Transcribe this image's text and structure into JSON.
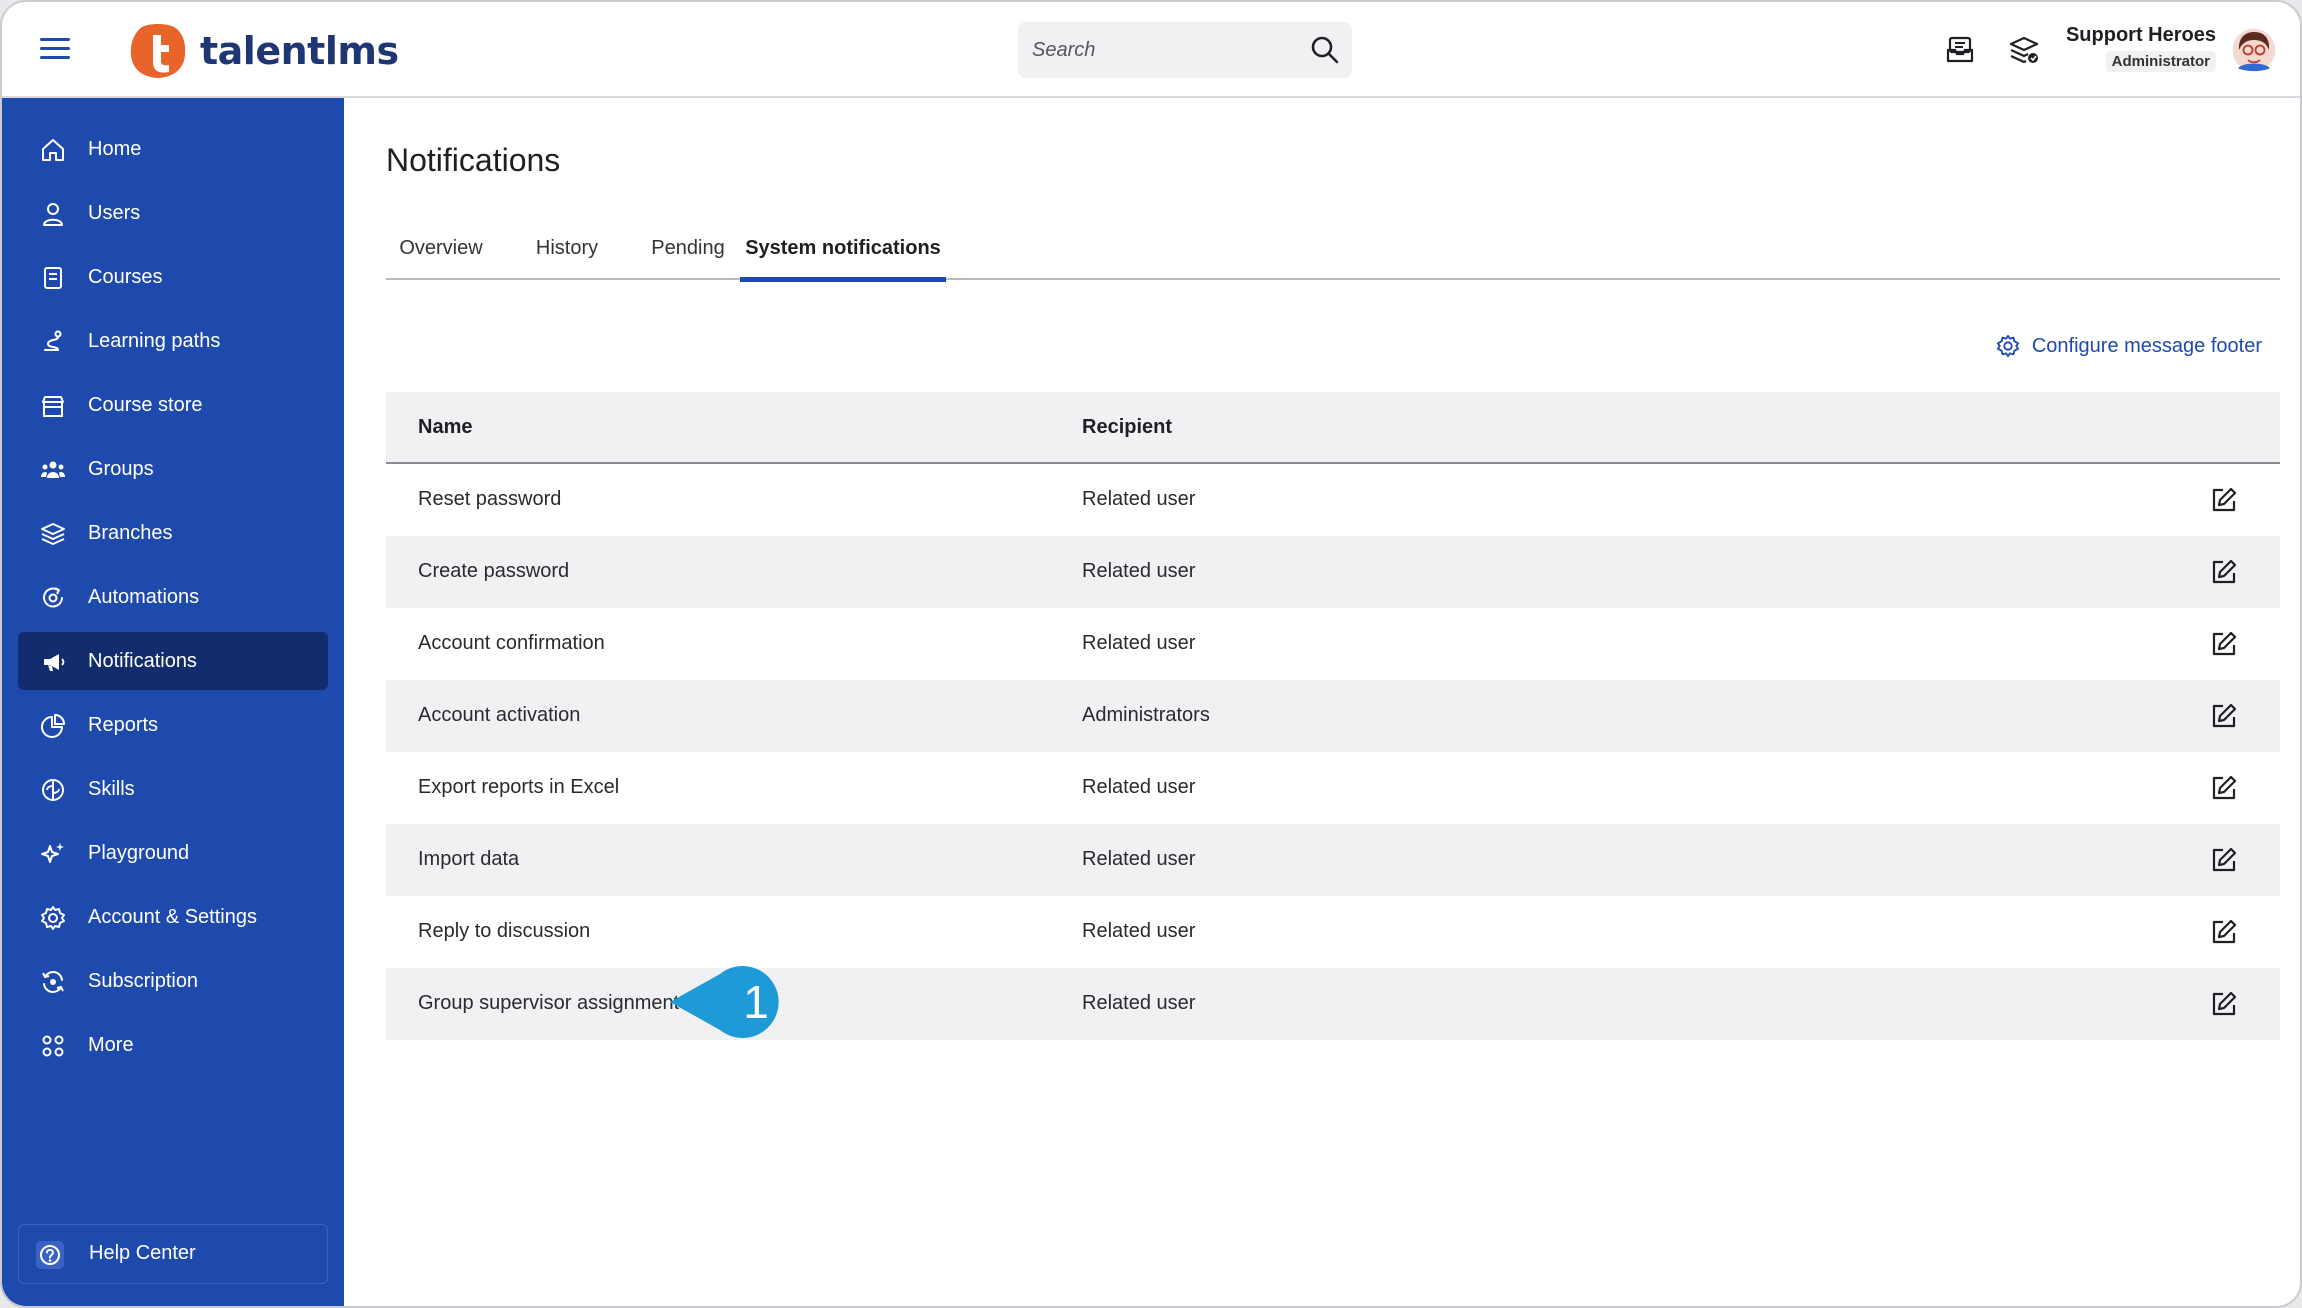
{
  "app": {
    "logo_text": "talentlms",
    "brand_orange": "#e8642a",
    "brand_blue": "#1f4aad"
  },
  "search": {
    "placeholder": "Search"
  },
  "user": {
    "name": "Support Heroes",
    "role": "Administrator"
  },
  "sidebar": {
    "items": [
      {
        "label": "Home",
        "icon": "home-icon"
      },
      {
        "label": "Users",
        "icon": "user-icon"
      },
      {
        "label": "Courses",
        "icon": "book-icon"
      },
      {
        "label": "Learning paths",
        "icon": "path-icon"
      },
      {
        "label": "Course store",
        "icon": "store-icon"
      },
      {
        "label": "Groups",
        "icon": "groups-icon"
      },
      {
        "label": "Branches",
        "icon": "layers-icon"
      },
      {
        "label": "Automations",
        "icon": "automation-icon"
      },
      {
        "label": "Notifications",
        "icon": "megaphone-icon",
        "active": true
      },
      {
        "label": "Reports",
        "icon": "pie-chart-icon"
      },
      {
        "label": "Skills",
        "icon": "brain-icon"
      },
      {
        "label": "Playground",
        "icon": "sparkle-icon"
      },
      {
        "label": "Account & Settings",
        "icon": "gear-icon"
      },
      {
        "label": "Subscription",
        "icon": "subscription-icon"
      },
      {
        "label": "More",
        "icon": "grid-icon"
      }
    ],
    "help": {
      "label": "Help Center",
      "icon": "help-icon"
    }
  },
  "main": {
    "title": "Notifications",
    "tabs": [
      {
        "label": "Overview"
      },
      {
        "label": "History"
      },
      {
        "label": "Pending"
      },
      {
        "label": "System notifications",
        "active": true
      }
    ],
    "config_link": "Configure message footer",
    "table": {
      "columns": [
        "Name",
        "Recipient"
      ],
      "rows": [
        {
          "name": "Reset password",
          "recipient": "Related user"
        },
        {
          "name": "Create password",
          "recipient": "Related user"
        },
        {
          "name": "Account confirmation",
          "recipient": "Related user"
        },
        {
          "name": "Account activation",
          "recipient": "Administrators"
        },
        {
          "name": "Export reports in Excel",
          "recipient": "Related user"
        },
        {
          "name": "Import data",
          "recipient": "Related user"
        },
        {
          "name": "Reply to discussion",
          "recipient": "Related user"
        },
        {
          "name": "Group supervisor assignment",
          "recipient": "Related user"
        }
      ]
    }
  },
  "callout": {
    "number": "1",
    "color": "#1e9bd7"
  }
}
